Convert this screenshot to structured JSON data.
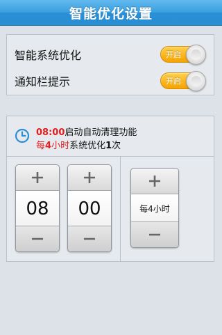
{
  "header": {
    "title": "智能优化设置"
  },
  "settings": {
    "items": [
      {
        "label": "智能系统优化",
        "toggle_text": "开启"
      },
      {
        "label": "通知栏提示",
        "toggle_text": "开启"
      }
    ]
  },
  "schedule": {
    "summary": {
      "time": "08:00",
      "line1_text": "启动自动清理功能",
      "prefix": "每",
      "hours": "4",
      "hours_unit": "小时",
      "line2_mid": "系统优化",
      "count": "1",
      "count_unit": "次"
    },
    "hour_value": "08",
    "minute_value": "00",
    "interval_value": "每4小时"
  },
  "colors": {
    "title_bar": "#3aa0e0",
    "toggle_on": "#f5a300",
    "highlight": "#e02020",
    "clock_icon": "#2b8fd6"
  }
}
